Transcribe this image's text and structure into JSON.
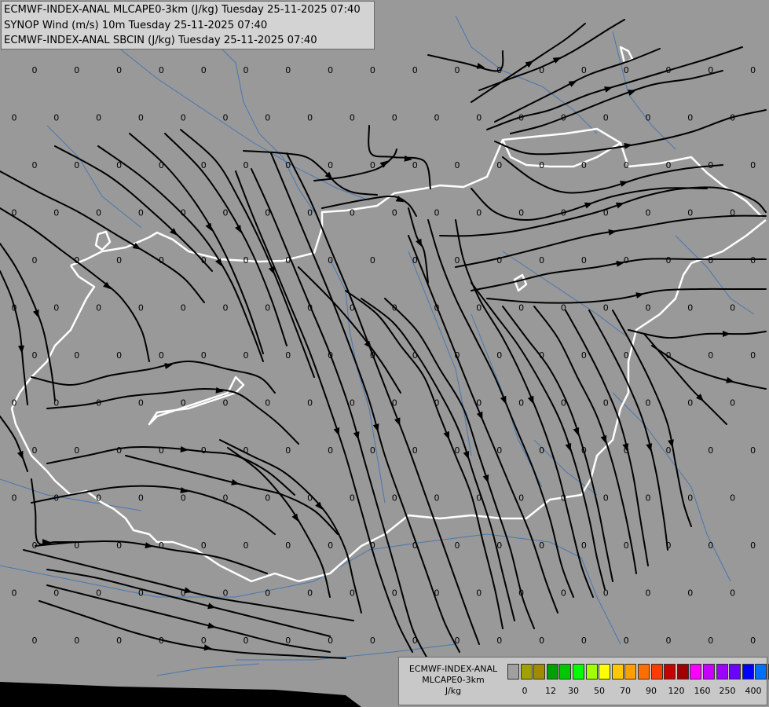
{
  "titles": {
    "line1": "ECMWF-INDEX-ANAL MLCAPE0-3km (J/kg) Tuesday 25-11-2025 07:40",
    "line2": "SYNOP Wind (m/s) 10m Tuesday 25-11-2025 07:40",
    "line3": "ECMWF-INDEX-ANAL SBCIN (J/kg) Tuesday 25-11-2025 07:40"
  },
  "legend": {
    "model": "ECMWF-INDEX-ANAL",
    "parameter": "MLCAPE0-3km",
    "unit": "J/kg",
    "colors": [
      "#a0a0a0",
      "#a0a000",
      "#a08c00",
      "#00a000",
      "#00c800",
      "#00ff00",
      "#a0ff00",
      "#ffff00",
      "#ffc800",
      "#ffa000",
      "#ff6e00",
      "#ff3c00",
      "#c80000",
      "#a00000",
      "#ff00ff",
      "#c800ff",
      "#a000ff",
      "#6e00ff",
      "#0000ff",
      "#006eff",
      "#00c8ff",
      "#00ffff",
      "#a0ffff",
      "#ffffff"
    ],
    "tick_labels": [
      "0",
      "12",
      "30",
      "50",
      "70",
      "90",
      "120",
      "160",
      "250",
      "400"
    ]
  },
  "map": {
    "background_color": "#999999",
    "river_color": "#4a77b0",
    "border_color": "#ffffff",
    "streamline_color": "#000000",
    "grid_value_label": "0",
    "grid_value": 0
  }
}
